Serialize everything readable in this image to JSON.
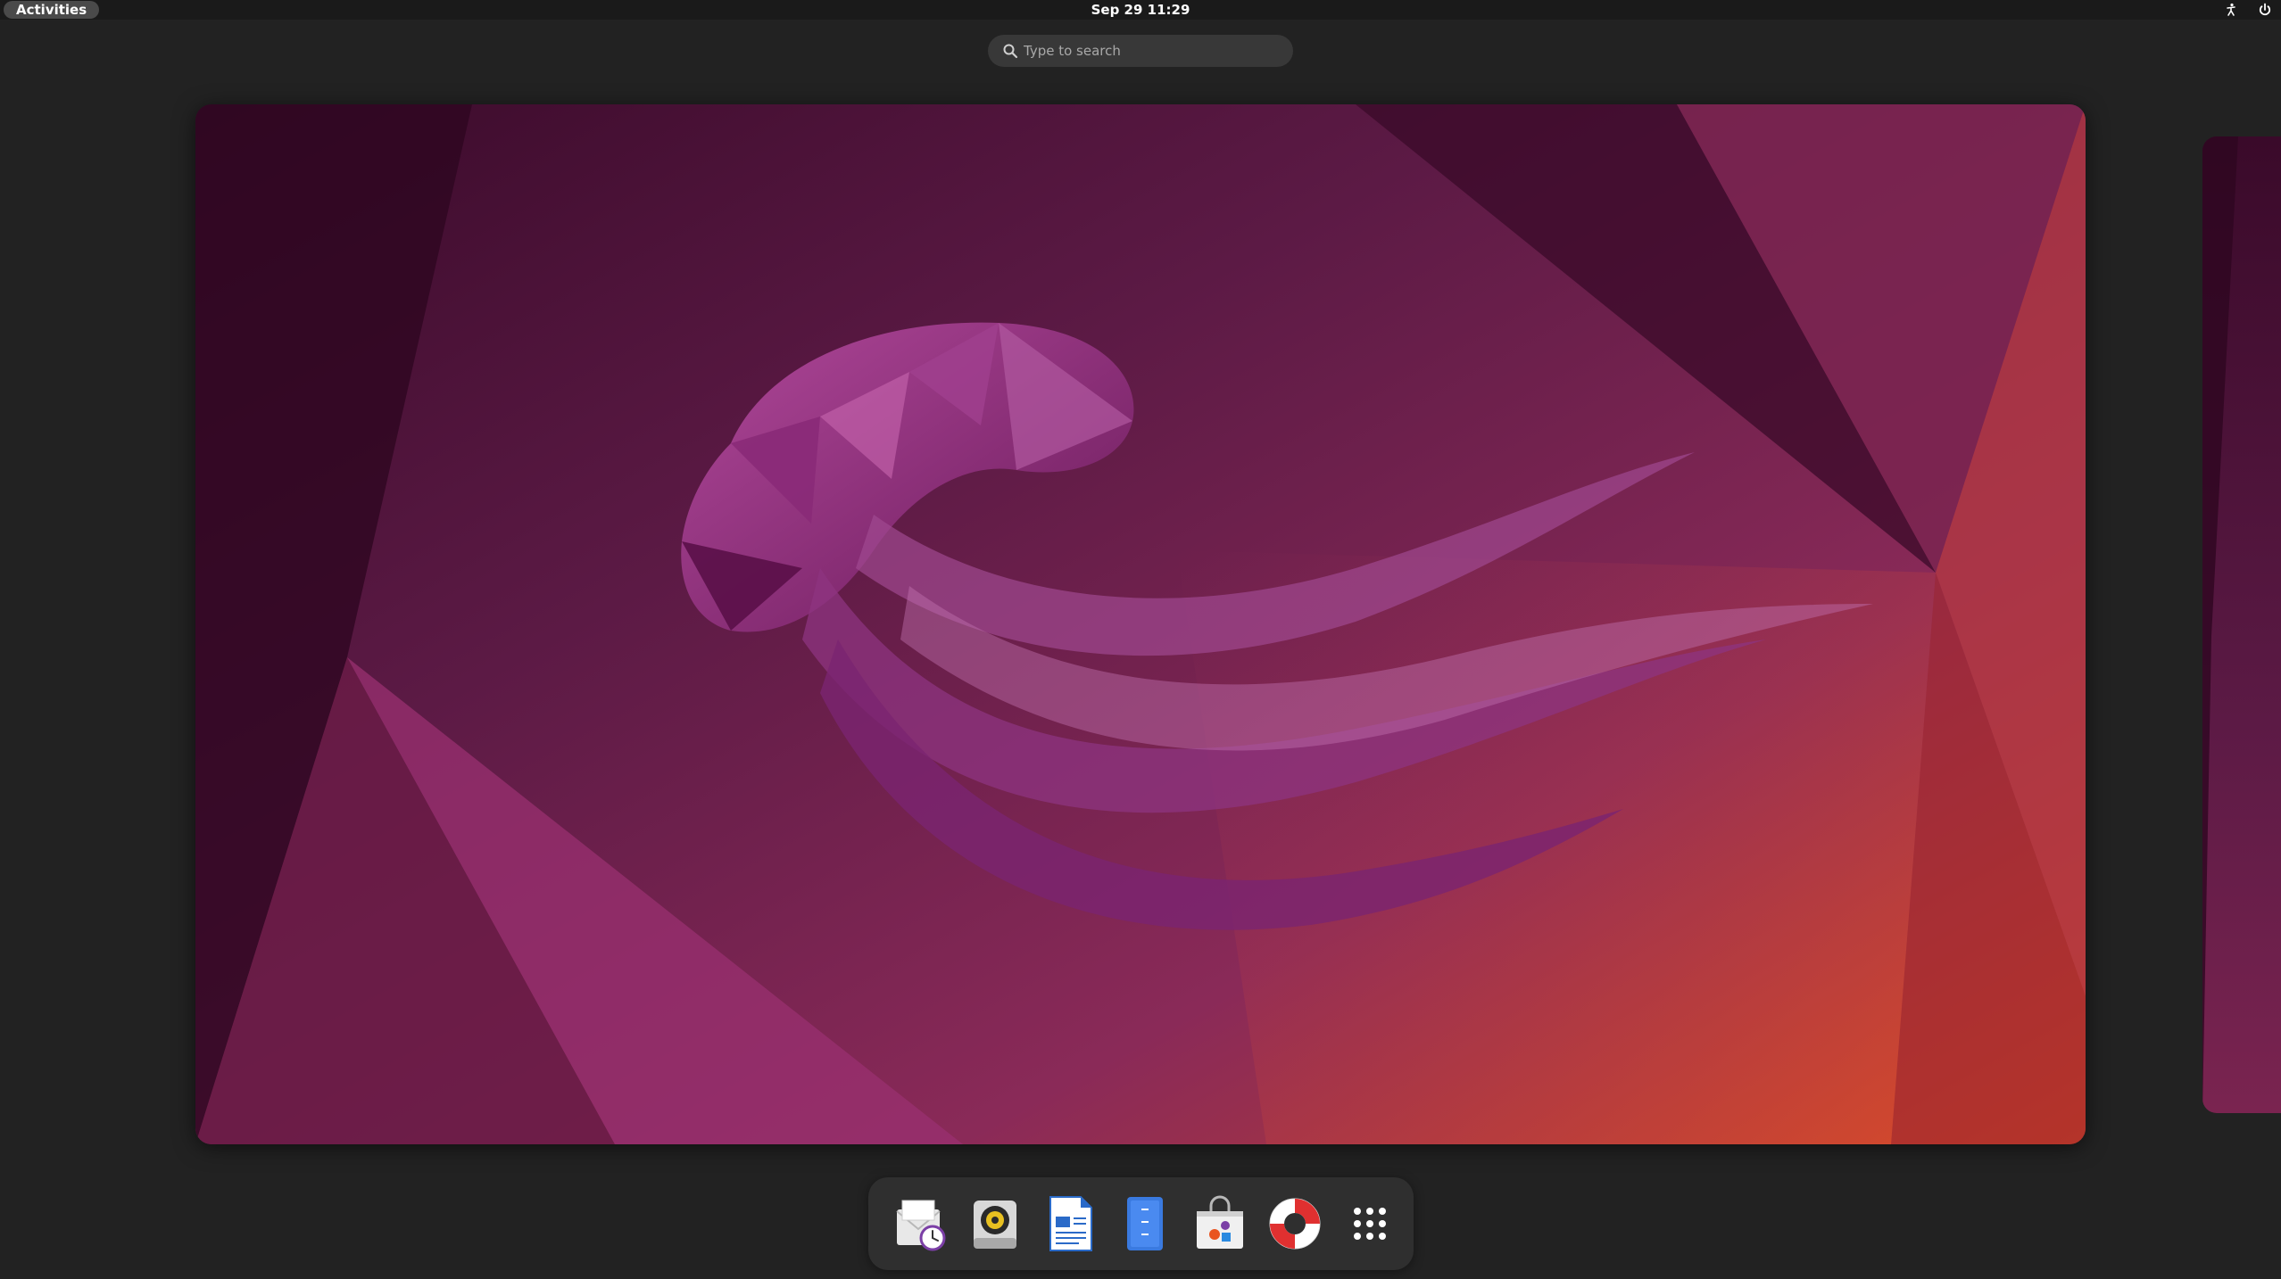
{
  "topbar": {
    "activities_label": "Activities",
    "clock": "Sep 29  11:29",
    "tray_icons": [
      "accessibility-icon",
      "power-icon"
    ]
  },
  "search": {
    "placeholder": "Type to search",
    "icon": "search-icon"
  },
  "workspace": {
    "wallpaper": "ubuntu-jellyfish-wallpaper"
  },
  "dock": {
    "apps": [
      {
        "name": "mail-clock-app",
        "icon": "mail-clock-icon"
      },
      {
        "name": "rhythmbox",
        "icon": "speaker-icon"
      },
      {
        "name": "writer",
        "icon": "document-icon"
      },
      {
        "name": "text-editor",
        "icon": "notepad-icon"
      },
      {
        "name": "software-store",
        "icon": "shopping-bag-icon"
      },
      {
        "name": "help",
        "icon": "lifebuoy-icon"
      },
      {
        "name": "show-apps",
        "icon": "grid-icon"
      }
    ]
  },
  "colors": {
    "panel": "#1a1a1a",
    "background": "#222222",
    "dock": "#2f2f2f",
    "search": "#383838",
    "accent": "#e95420"
  }
}
